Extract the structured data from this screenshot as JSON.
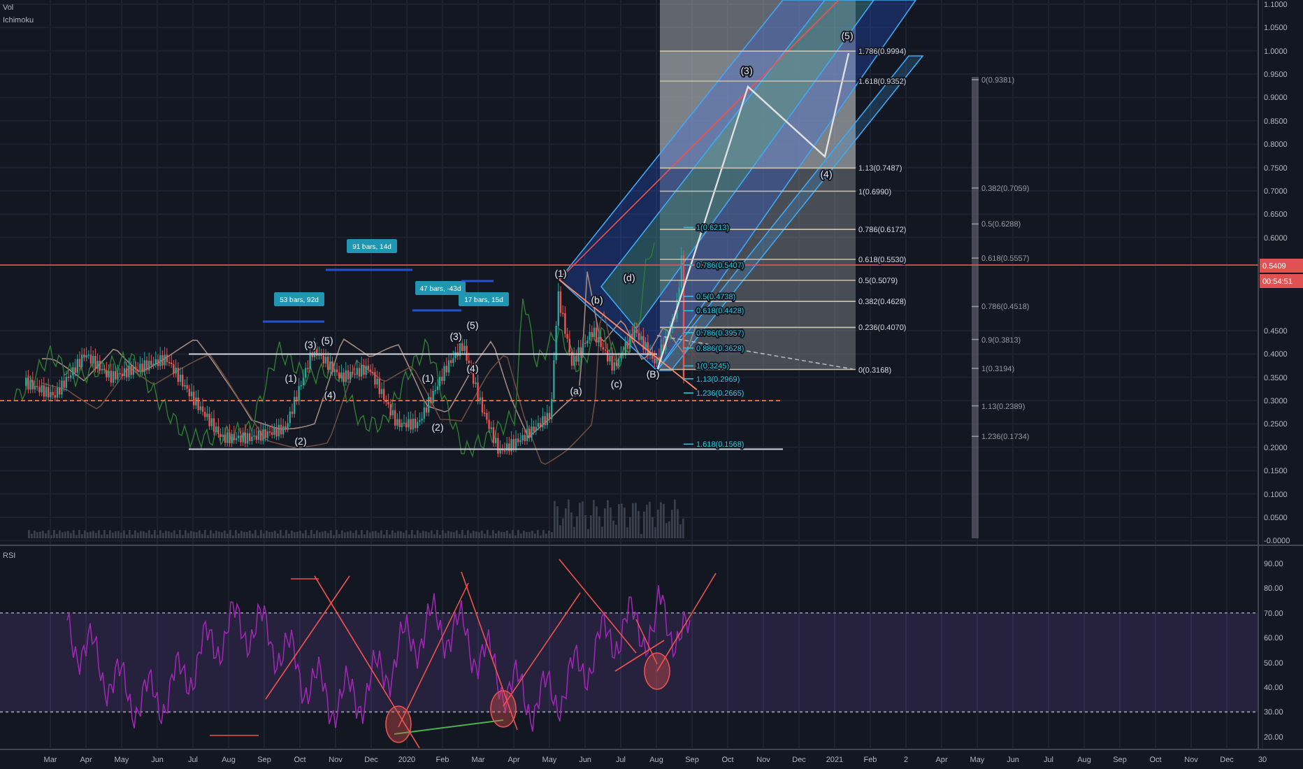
{
  "legend": {
    "volume": "Vol",
    "indicator": "Ichimoku"
  },
  "price_axis": [
    "1.1000",
    "1.0500",
    "1.0000",
    "0.9500",
    "0.9000",
    "0.8500",
    "0.8000",
    "0.7500",
    "0.7000",
    "0.6500",
    "0.6000",
    "0.4500",
    "0.4000",
    "0.3500",
    "0.3000",
    "0.2500",
    "0.2000",
    "0.1500",
    "0.1000",
    "0.0500",
    "-0.0000"
  ],
  "price_tags": [
    {
      "label": "0.5409",
      "color": "#e05252"
    },
    {
      "label": "00:54:51",
      "color": "#e05252"
    }
  ],
  "fib_box": [
    "1.786(0.9994)",
    "1.618(0.9352)",
    "1.13(0.7487)",
    "1(0.6990)",
    "0.786(0.6172)",
    "0.618(0.5530)",
    "0.5(0.5079)",
    "0.382(0.4628)",
    "0.236(0.4070)",
    "0(0.3168)"
  ],
  "fib_extension": [
    "1(0.6213)",
    "0.786(0.5407)",
    "0.5(0.4738)",
    "0.618(0.4428)",
    "0.786(0.3957)",
    "0.886(0.3628)",
    "1(0.3245)",
    "1.13(0.2969)",
    "1.236(0.2665)",
    "1.618(0.1568)"
  ],
  "fib_side": [
    "0(0.9381)",
    "0.382(0.7059)",
    "0.5(0.6288)",
    "0.618(0.5557)",
    "0.786(0.4518)",
    "0.9(0.3813)",
    "1(0.3194)",
    "1.13(0.2389)",
    "1.236(0.1734)"
  ],
  "wave_labels": [
    "(1)",
    "(2)",
    "(3)",
    "(4)",
    "(5)",
    "(1)",
    "(2)",
    "(3)",
    "(4)",
    "(5)",
    "(1)",
    "(a)",
    "(b)",
    "(c)",
    "(d)",
    "(B)",
    "(3)",
    "(4)",
    "(5)"
  ],
  "range_labels": [
    "53 bars, 92d",
    "91 bars, 14d",
    "47 bars, -43d",
    "17 bars, 15d"
  ],
  "rsi": {
    "title": "RSI",
    "axis": [
      "90.00",
      "80.00",
      "70.00",
      "60.00",
      "50.00",
      "40.00",
      "30.00",
      "20.00"
    ]
  },
  "time_axis": [
    "Mar",
    "Apr",
    "May",
    "Jun",
    "Jul",
    "Aug",
    "Sep",
    "Oct",
    "Nov",
    "Dec",
    "2020",
    "Feb",
    "Mar",
    "Apr",
    "May",
    "Jun",
    "Jul",
    "Aug",
    "Sep",
    "Oct",
    "Nov",
    "Dec",
    "2021",
    "Feb",
    "2",
    "Apr",
    "May",
    "Jun",
    "Jul",
    "Aug",
    "Sep",
    "Oct",
    "Nov",
    "Dec",
    "30"
  ]
}
